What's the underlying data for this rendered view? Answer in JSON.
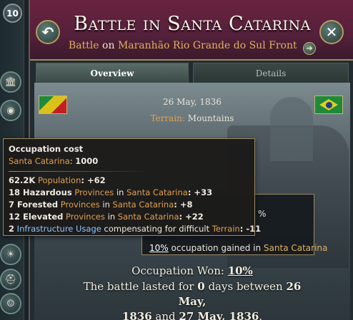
{
  "sidebar": {
    "level": "10"
  },
  "header": {
    "title": "Battle in Santa Catarina",
    "subtitle": {
      "battle_word": "Battle",
      "on_word": "on",
      "front": "Maranhão Rio Grande do Sul Front"
    }
  },
  "tabs": [
    {
      "label": "Overview"
    },
    {
      "label": "Details"
    }
  ],
  "scene": {
    "date": "26 May, 1836",
    "terrain_label": "Terrain:",
    "terrain_value": "Mountains"
  },
  "result": {
    "partial_pct": "%",
    "occupation_pct": "10%",
    "occupation_text": "occupation gained in",
    "occupation_place": "Santa Catarina",
    "won_label": "Occupation Won:",
    "won_value": "10%",
    "lasted_1": "The battle lasted for",
    "lasted_days": "0",
    "lasted_2": "days between",
    "start_date_a": "26 May,",
    "start_date_b": "1836",
    "and_word": "and",
    "end_date": "27 May, 1836",
    "period": "."
  },
  "tooltip": {
    "title": "Occupation cost",
    "place": "Santa Catarina",
    "place_value": "1000",
    "rows": [
      {
        "a": "62.2K",
        "b": "Population",
        "c": ": +62"
      },
      {
        "a": "18 Hazardous",
        "b": "Provinces",
        "mid": "in",
        "d": "Santa Catarina",
        "c": ": +33"
      },
      {
        "a": "7 Forested",
        "b": "Provinces",
        "mid": "in",
        "d": "Santa Catarina",
        "c": ": +8"
      },
      {
        "a": "12 Elevated",
        "b": "Provinces",
        "mid": "in",
        "d": "Santa Catarina",
        "c": ": +22"
      },
      {
        "a": "2",
        "b": "Infrastructure Usage",
        "mid": "compensating for difficult",
        "d": "Terrain",
        "c": ": -11"
      }
    ]
  }
}
